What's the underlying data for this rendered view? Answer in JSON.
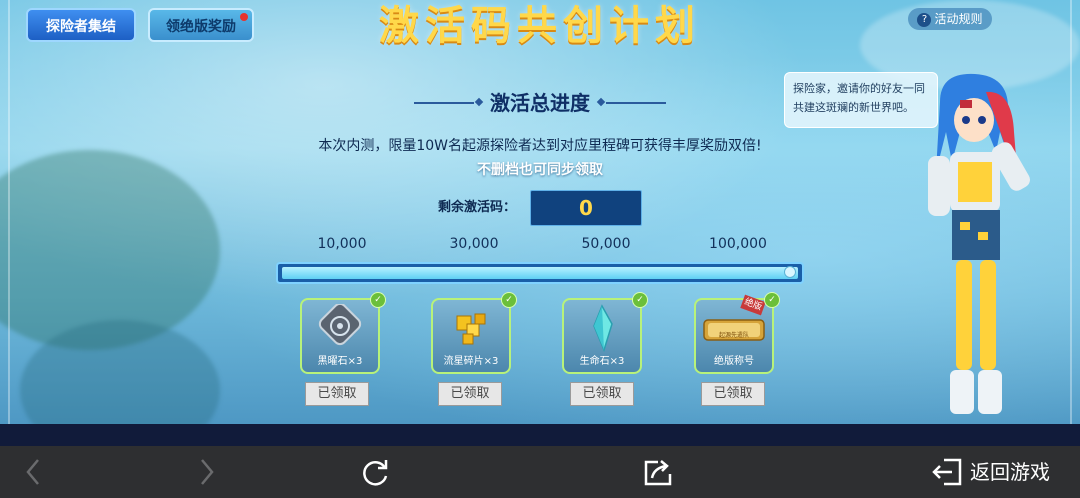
{
  "header": {
    "title": "激活码共创计划",
    "tab_explorer": "探险者集结",
    "tab_reward": "领绝版奖励",
    "rules": "活动规则"
  },
  "bubble_text": "探险家，邀请你的好友一同共建这斑斓的新世界吧。",
  "section": {
    "title": "激活总进度",
    "desc": "本次内测，限量10W名起源探险者达到对应里程碑可获得丰厚奖励双倍!",
    "note": "不删档也可同步领取",
    "remain_label": "剩余激活码：",
    "remain_value": "0"
  },
  "milestones": [
    "10,000",
    "30,000",
    "50,000",
    "100,000"
  ],
  "progress": 1.0,
  "rewards": [
    {
      "name": "黑曜石×3",
      "icon": "obsidian-icon",
      "claimed": "已领取"
    },
    {
      "name": "流星碎片×3",
      "icon": "meteor-fragment-icon",
      "claimed": "已领取"
    },
    {
      "name": "生命石×3",
      "icon": "life-stone-icon",
      "claimed": "已领取"
    },
    {
      "name": "绝版称号",
      "icon": "title-plaque-icon",
      "claimed": "已领取",
      "badge": "绝版",
      "plaque_text": "起源先遣队"
    }
  ],
  "navbar": {
    "back_game": "返回游戏"
  },
  "colors": {
    "title": "#ffd84a",
    "accent_blue": "#1d5fc4",
    "check_green": "#6bbf3a",
    "nav_bg": "#2e2f31"
  }
}
